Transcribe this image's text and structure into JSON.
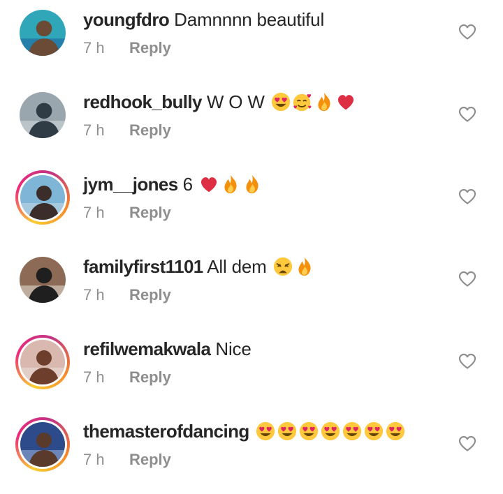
{
  "comments": [
    {
      "username": "youngfdro",
      "text": "Damnnnn beautiful",
      "emojis": [],
      "time": "7 h",
      "reply_label": "Reply",
      "avatar_ring": false,
      "avatar_palette": [
        "#2fa7b8",
        "#6b4a36",
        "#1d5fa0"
      ]
    },
    {
      "username": "redhook_bully",
      "text": "W O W",
      "emojis": [
        "heart-eyes",
        "smiling-hearts",
        "fire",
        "red-heart"
      ],
      "time": "7 h",
      "reply_label": "Reply",
      "avatar_ring": false,
      "avatar_palette": [
        "#9aa6ae",
        "#2f3b45",
        "#d7dde0"
      ]
    },
    {
      "username": "jym__jones",
      "text": "6",
      "emojis": [
        "red-heart",
        "fire",
        "fire"
      ],
      "time": "7 h",
      "reply_label": "Reply",
      "avatar_ring": true,
      "avatar_palette": [
        "#7fb6d8",
        "#3b2e2a",
        "#c9d9e6"
      ]
    },
    {
      "username": "familyfirst1101",
      "text": "All dem",
      "emojis": [
        "weary-face",
        "fire"
      ],
      "time": "7 h",
      "reply_label": "Reply",
      "avatar_ring": false,
      "avatar_palette": [
        "#8c6a55",
        "#1f1f1f",
        "#e8e4dc"
      ]
    },
    {
      "username": "refilwemakwala",
      "text": "Nice",
      "emojis": [],
      "time": "7 h",
      "reply_label": "Reply",
      "avatar_ring": true,
      "avatar_palette": [
        "#d9b8b0",
        "#6e3e2c",
        "#eae0da"
      ]
    },
    {
      "username": "themasterofdancing",
      "text": "",
      "emojis": [
        "heart-eyes",
        "heart-eyes",
        "heart-eyes",
        "heart-eyes",
        "heart-eyes",
        "heart-eyes",
        "heart-eyes"
      ],
      "time": "7 h",
      "reply_label": "Reply",
      "avatar_ring": true,
      "avatar_palette": [
        "#2d4a8a",
        "#5a3a2a",
        "#9fb6e0"
      ]
    }
  ],
  "colors": {
    "text": "#262626",
    "meta": "#8e8e8e",
    "heart_outline": "#8e8e8e",
    "emoji_yellow": "#ffc83d",
    "emoji_heart": "#e0245e",
    "fire_orange": "#f4900c"
  }
}
